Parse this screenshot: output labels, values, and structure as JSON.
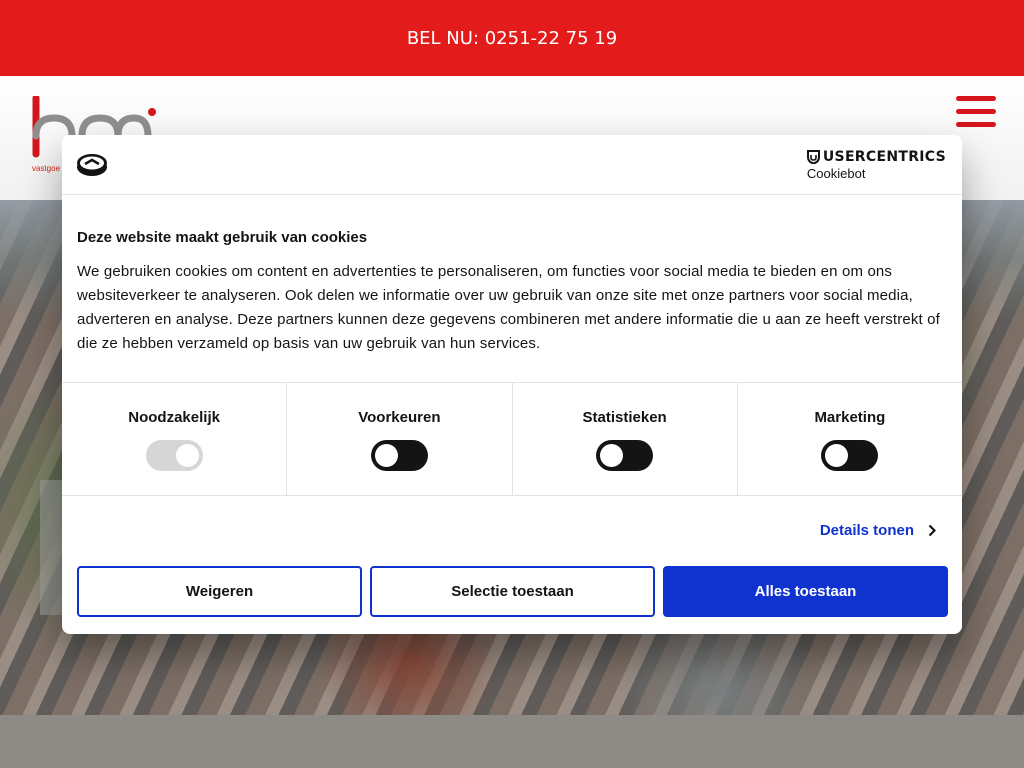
{
  "topbar": {
    "phone_text": "BEL NU: 0251-22 75 19"
  },
  "header": {
    "logo_text": "vastgoe"
  },
  "cookie_dialog": {
    "brand": "USERCENTRICS",
    "sub_brand": "Cookiebot",
    "title": "Deze website maakt gebruik van cookies",
    "body": "We gebruiken cookies om content en advertenties te personaliseren, om functies voor social media te bieden en om ons websiteverkeer te analyseren. Ook delen we informatie over uw gebruik van onze site met onze partners voor social media, adverteren en analyse. Deze partners kunnen deze gegevens combineren met andere informatie die u aan ze heeft verstrekt of die ze hebben verzameld op basis van uw gebruik van hun services.",
    "categories": [
      {
        "label": "Noodzakelijk",
        "enabled": true,
        "locked": true
      },
      {
        "label": "Voorkeuren",
        "enabled": false,
        "locked": false
      },
      {
        "label": "Statistieken",
        "enabled": false,
        "locked": false
      },
      {
        "label": "Marketing",
        "enabled": false,
        "locked": false
      }
    ],
    "details_label": "Details tonen",
    "buttons": {
      "reject": "Weigeren",
      "selection": "Selectie toestaan",
      "accept_all": "Alles toestaan"
    }
  },
  "colors": {
    "brand_red": "#e31b1b",
    "accent_blue": "#1032cf",
    "toggle_dark": "#141414"
  },
  "icons": [
    "cookie-icon",
    "usercentrics-shield-icon",
    "hamburger-menu-icon",
    "chevron-right-icon"
  ]
}
